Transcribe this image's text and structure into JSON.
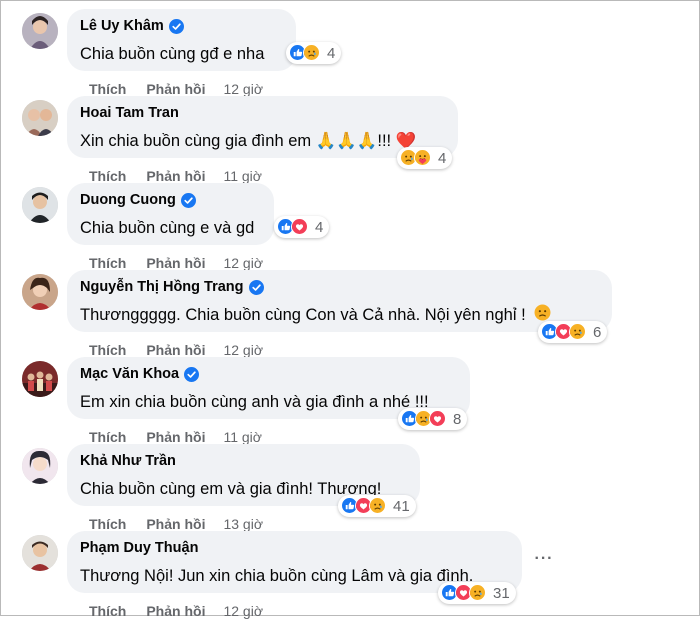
{
  "colors": {
    "bubble": "#f0f2f5",
    "meta_text": "#65676b",
    "verified_blue": "#1877f2",
    "like_blue": "#1877f2",
    "love_red": "#f33e58",
    "sad_yellow": "#f7b125"
  },
  "actions": {
    "like_label": "Thích",
    "reply_label": "Phản hồi"
  },
  "comments": [
    {
      "author": "Lê Uy Khâm",
      "verified": true,
      "text": "Chia buồn cùng gđ e nha",
      "reactions": [
        "like",
        "sad"
      ],
      "reaction_count": "4",
      "time": "12 giờ"
    },
    {
      "author": "Hoai Tam Tran",
      "verified": false,
      "text": "Xin chia buồn cùng gia đình em 🙏🙏🙏!!! ❤️",
      "reactions": [
        "sad",
        "care"
      ],
      "reaction_count": "4",
      "time": "11 giờ"
    },
    {
      "author": "Duong Cuong",
      "verified": true,
      "text": "Chia buồn cùng e và gd",
      "reactions": [
        "like",
        "love"
      ],
      "reaction_count": "4",
      "time": "12 giờ"
    },
    {
      "author": "Nguyễn Thị Hồng Trang",
      "verified": true,
      "text": "Thươnggggg. Chia buồn cùng Con và Cả nhà. Nội yên nghỉ !",
      "reactions": [
        "like",
        "love",
        "sad"
      ],
      "reaction_count": "6",
      "time": "12 giờ"
    },
    {
      "author": "Mạc Văn Khoa",
      "verified": true,
      "text": "Em xin chia buồn cùng anh và gia đình a nhé !!!",
      "reactions": [
        "like",
        "sad",
        "love"
      ],
      "reaction_count": "8",
      "time": "11 giờ"
    },
    {
      "author": "Khả Như Trần",
      "verified": false,
      "text": "Chia buồn cùng em và gia đình! Thương!",
      "reactions": [
        "like",
        "love",
        "sad"
      ],
      "reaction_count": "41",
      "time": "13 giờ"
    },
    {
      "author": "Phạm Duy Thuận",
      "verified": false,
      "text": "Thương Nội! Jun xin chia buồn cùng Lâm và gia đình.",
      "reactions": [
        "like",
        "love",
        "sad"
      ],
      "reaction_count": "31",
      "time": "12 giờ"
    }
  ]
}
